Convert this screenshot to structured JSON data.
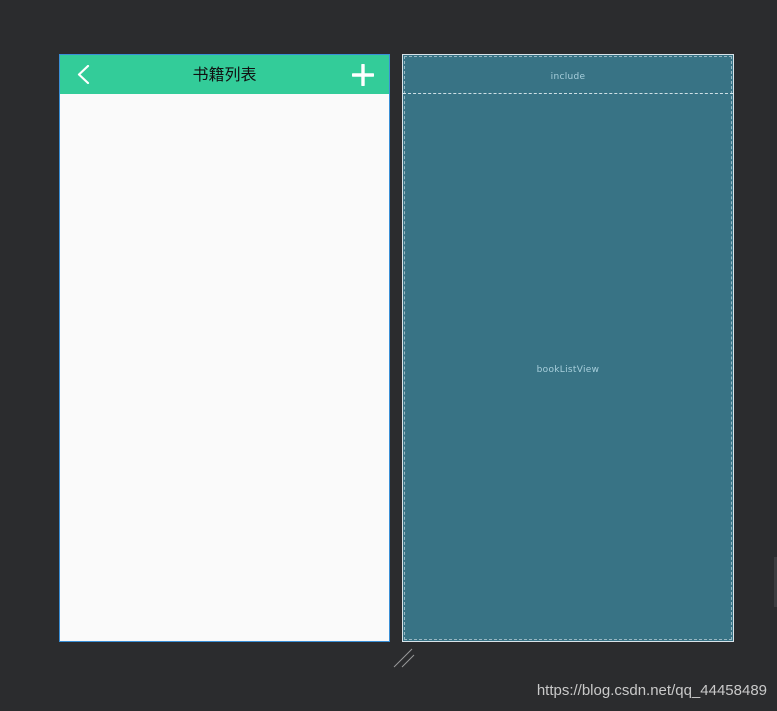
{
  "design_preview": {
    "title": "书籍列表",
    "back_icon": "chevron-left-icon",
    "add_icon": "plus-icon",
    "titlebar_color": "#33cc99",
    "background_color": "#fafafa"
  },
  "blueprint_preview": {
    "include_label": "include",
    "list_label": "bookListView",
    "background_color": "#387385"
  },
  "watermark": "https://blog.csdn.net/qq_44458489"
}
